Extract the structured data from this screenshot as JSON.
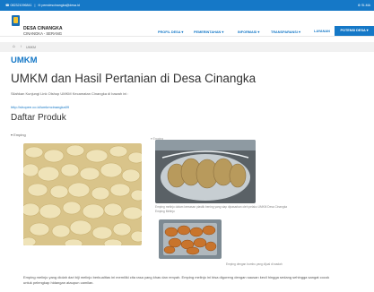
{
  "topbar": {
    "phone": "☎ 082321096841",
    "separator": "|",
    "email": "✉ pemdescinangka@desa.id",
    "right": "⚙ SI-MA"
  },
  "header": {
    "village_name": "DESA CINANGKA",
    "village_subtitle": "CINANGKA - SERANG",
    "nav": [
      "PROFIL DESA ▾",
      "PEMERINTAHAN ▾",
      "INFORMASI ▾",
      "TRANSPARANSI ▾",
      "LAYANAN"
    ],
    "nav_active": "POTENSI DESA ▾"
  },
  "breadcrumb": {
    "home_icon": "home-icon",
    "separator": "/",
    "current": "UMKM"
  },
  "page": {
    "section_title": "UMKM",
    "heading": "UMKM dan Hasil Pertanian di Desa Cinangka",
    "intro": "Silahkan Kunjungi Link Olshop UMKM Kecamatan Cinangka di bawah ini :",
    "link": "http://shopee.co.id/umkmcinangka09",
    "subheading": "Daftar Produk"
  },
  "product": {
    "accordion_label": "▾ Emping",
    "image_label": "▾ Emping",
    "caption_bag": "Emping melinjo dalam kemasan plastik bening yang siap dipasarkan oleh pelaku UMKM Desa Cinangka",
    "caption_bag2": "Emping Melinjo",
    "caption_tray": "Emping dengan bumbu yang dijual di wadah",
    "description_1": "Emping melinjo yang diolah dari biji melinjo berkualitas ini memiliki cita rasa yang khas dan renyah. Emping melinjo ini bisa digoreng dengan sausan kecil hingga sedang sehingga sangat cocok",
    "description_2": "untuk pelengkap hidangan ataupun camilan."
  },
  "colors": {
    "primary": "#1578c7",
    "accent": "#f2c230"
  }
}
